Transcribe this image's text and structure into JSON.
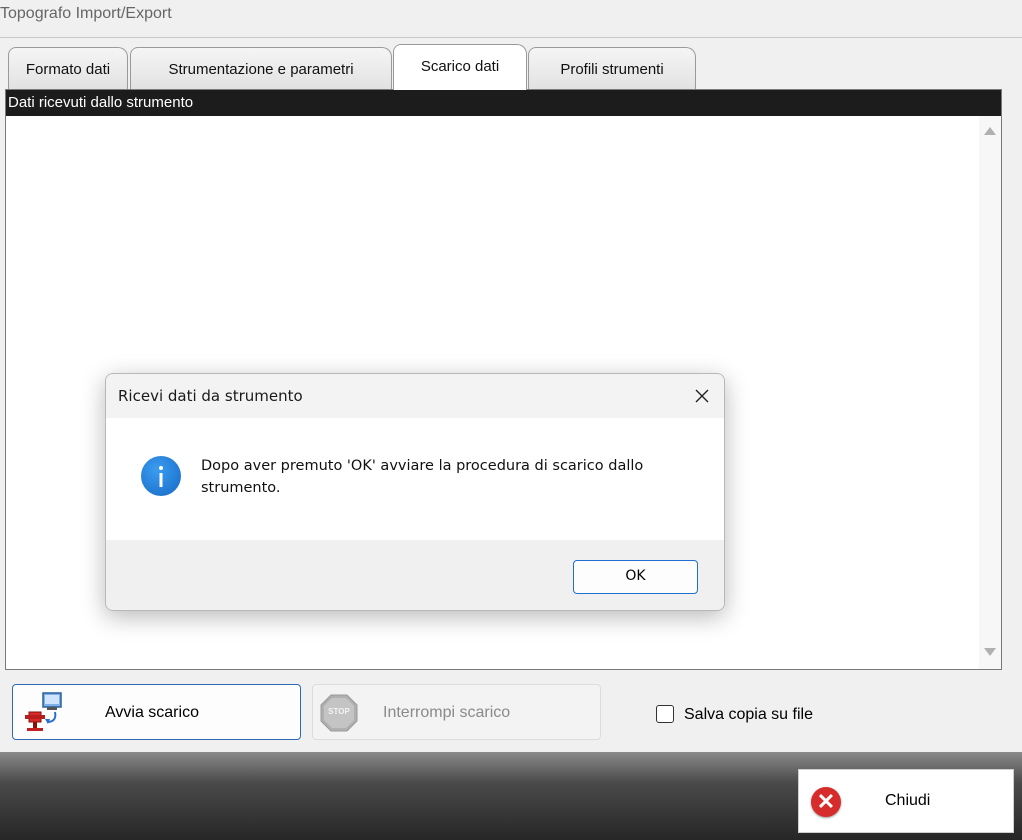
{
  "window": {
    "title": "Topografo Import/Export"
  },
  "tabs": [
    {
      "label": "Formato dati",
      "active": false
    },
    {
      "label": "Strumentazione e parametri",
      "active": false
    },
    {
      "label": "Scarico dati",
      "active": true
    },
    {
      "label": "Profili strumenti",
      "active": false
    }
  ],
  "panel": {
    "header": "Dati ricevuti dallo strumento",
    "content": ""
  },
  "actions": {
    "start_label": "Avvia scarico",
    "stop_label": "Interrompi scarico",
    "stop_icon_text": "STOP",
    "save_copy_label": "Salva copia su file",
    "save_copy_checked": false
  },
  "footer": {
    "close_label": "Chiudi"
  },
  "dialog": {
    "title": "Ricevi dati da strumento",
    "message": "Dopo aver premuto 'OK' avviare la procedura di scarico dallo strumento.",
    "ok_label": "OK",
    "icon": "info-icon"
  },
  "colors": {
    "accent": "#2b6cb5",
    "header_bg": "#1c1c1c",
    "info_blue": "#1e7fd9",
    "close_red": "#d72c2c"
  }
}
